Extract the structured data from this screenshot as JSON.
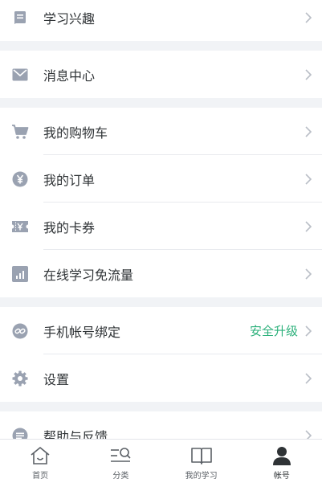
{
  "menu": {
    "learning_interest": "学习兴趣",
    "message_center": "消息中心",
    "cart": "我的购物车",
    "orders": "我的订单",
    "coupons": "我的卡券",
    "free_data": "在线学习免流量",
    "bind_phone": "手机帐号绑定",
    "bind_phone_status": "安全升级",
    "settings": "设置",
    "help_feedback": "帮助与反馈"
  },
  "tabs": {
    "home": "首页",
    "category": "分类",
    "my_learning": "我的学习",
    "account": "帐号"
  },
  "colors": {
    "icon": "#9aa2b1",
    "accent": "#2bb07a",
    "text": "#2f3336"
  }
}
